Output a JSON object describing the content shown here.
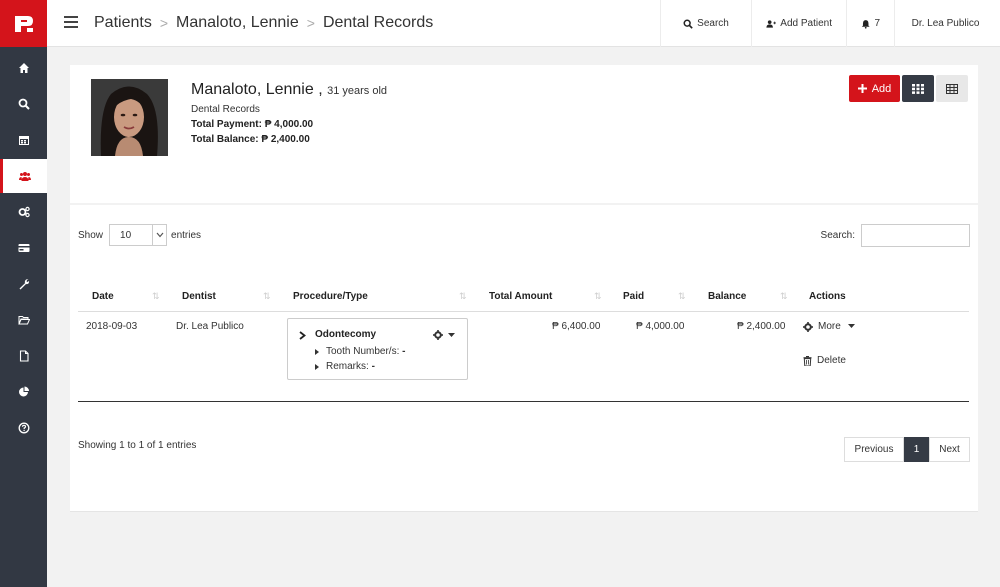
{
  "app": {
    "logo_letter": "P",
    "brand_color": "#d4141b",
    "dark_color": "#323843"
  },
  "sidebar": {
    "items": [
      {
        "icon": "home-icon"
      },
      {
        "icon": "search-icon"
      },
      {
        "icon": "calendar-icon"
      },
      {
        "icon": "users-icon",
        "active": true
      },
      {
        "icon": "cogs-icon"
      },
      {
        "icon": "credit-card-icon"
      },
      {
        "icon": "wrench-icon"
      },
      {
        "icon": "folder-open-icon"
      },
      {
        "icon": "file-icon"
      },
      {
        "icon": "pie-chart-icon"
      },
      {
        "icon": "help-icon"
      }
    ]
  },
  "header": {
    "breadcrumbs": [
      "Patients",
      "Manaloto, Lennie",
      "Dental Records"
    ],
    "search_label": "Search",
    "add_patient_label": "Add Patient",
    "notifications_count": "7",
    "user_label": "Dr. Lea Publico"
  },
  "patient": {
    "name": "Manaloto, Lennie ,",
    "age": "31 years old",
    "section": "Dental Records",
    "total_payment": "Total Payment: ₱ 4,000.00",
    "total_balance": "Total Balance: ₱ 2,400.00"
  },
  "toolbar": {
    "add_label": "Add"
  },
  "table_controls": {
    "show_label": "Show",
    "entries_value": "10",
    "entries_label": "entries",
    "search_label": "Search:",
    "search_value": ""
  },
  "table": {
    "columns": [
      "Date",
      "Dentist",
      "Procedure/Type",
      "Total Amount",
      "Paid",
      "Balance",
      "Actions"
    ],
    "rows": [
      {
        "date": "2018-09-03",
        "dentist": "Dr. Lea Publico",
        "procedure": "Odontecomy",
        "tooth_label": "Tooth Number/s:",
        "tooth_value": "-",
        "remarks_label": "Remarks:",
        "remarks_value": "-",
        "total_amount": "₱ 6,400.00",
        "paid": "₱ 4,000.00",
        "balance": "₱ 2,400.00",
        "more_label": "More",
        "delete_label": "Delete"
      }
    ]
  },
  "footer": {
    "showing_text": "Showing 1 to 1 of 1 entries",
    "prev_label": "Previous",
    "current_page": "1",
    "next_label": "Next"
  }
}
